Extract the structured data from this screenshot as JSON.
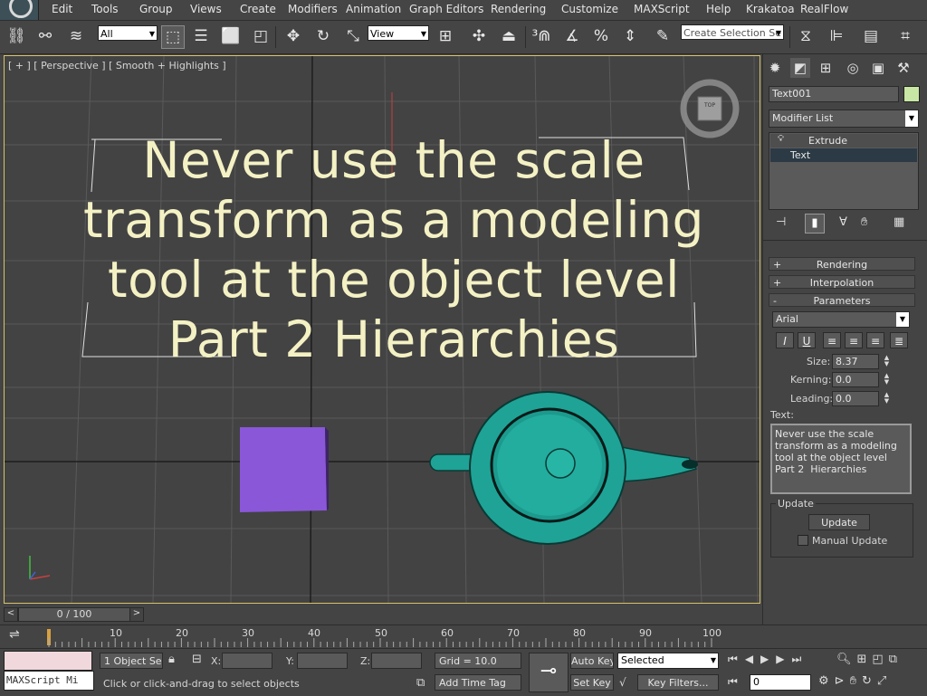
{
  "menu": {
    "items": [
      "Edit",
      "Tools",
      "Group",
      "Views",
      "Create",
      "Modifiers",
      "Animation",
      "Graph Editors",
      "Rendering",
      "Customize",
      "MAXScript",
      "Help",
      "Krakatoa",
      "RealFlow"
    ]
  },
  "toolbar": {
    "filter_value": "All",
    "refcoord_value": "View",
    "selection_set_placeholder": "Create Selection Se",
    "icons": [
      "link-icon",
      "unlink-icon",
      "bind-spacewarp-icon",
      "select-object-icon",
      "select-by-name-icon",
      "rect-select-icon",
      "window-crossing-icon",
      "move-icon",
      "rotate-icon",
      "scale-icon",
      "pivot-icon",
      "selection-center-icon",
      "manipulate-icon",
      "keyboard-shortcut-icon",
      "snap-3-icon",
      "angle-snap-icon",
      "percent-snap-icon",
      "spinner-snap-icon",
      "edit-named-sets-icon",
      "mirror-icon",
      "align-icon",
      "layer-manager-icon",
      "graphite-icon",
      "curve-editor-icon"
    ]
  },
  "viewport": {
    "label": "[ + ] [ Perspective ] [ Smooth + Highlights ]",
    "overlay_lines": [
      "Never use the scale",
      "transform as a modeling",
      "tool at the object level",
      "Part 2  Hierarchies"
    ],
    "viewcube_label": "TOP",
    "colors": {
      "box": "#8a57d9",
      "teapot": "#1fa396",
      "text": "#f4f1c4"
    }
  },
  "command_panel": {
    "object_name": "Text001",
    "object_color": "#c8e6a4",
    "modifier_list_label": "Modifier List",
    "stack": [
      "Extrude",
      "Text"
    ],
    "rollouts": {
      "rendering": "Rendering",
      "interpolation": "Interpolation",
      "parameters": "Parameters"
    },
    "font_value": "Arial",
    "size_label": "Size:",
    "size_value": "8.37",
    "kerning_label": "Kerning:",
    "kerning_value": "0.0",
    "leading_label": "Leading:",
    "leading_value": "0.0",
    "text_label": "Text:",
    "text_value": "Never use the scale\ntransform as a modeling\ntool at the object level\nPart 2  Hierarchies",
    "update_group": "Update",
    "update_button": "Update",
    "manual_update_label": "Manual Update"
  },
  "timeline": {
    "slider_label": "0 / 100",
    "ticks": [
      "10",
      "20",
      "30",
      "40",
      "50",
      "60",
      "70",
      "80",
      "90",
      "100"
    ]
  },
  "status": {
    "maxscript_label": "MAXScript Mi",
    "selection_info": "1 Object Sele",
    "x_label": "X:",
    "y_label": "Y:",
    "z_label": "Z:",
    "grid": "Grid = 10.0",
    "prompt": "Click or click-and-drag to select objects",
    "add_time_tag": "Add Time Tag",
    "auto_key": "Auto Key",
    "set_key": "Set Key",
    "key_mode_value": "Selected",
    "key_filters": "Key Filters...",
    "frame_value": "0"
  }
}
